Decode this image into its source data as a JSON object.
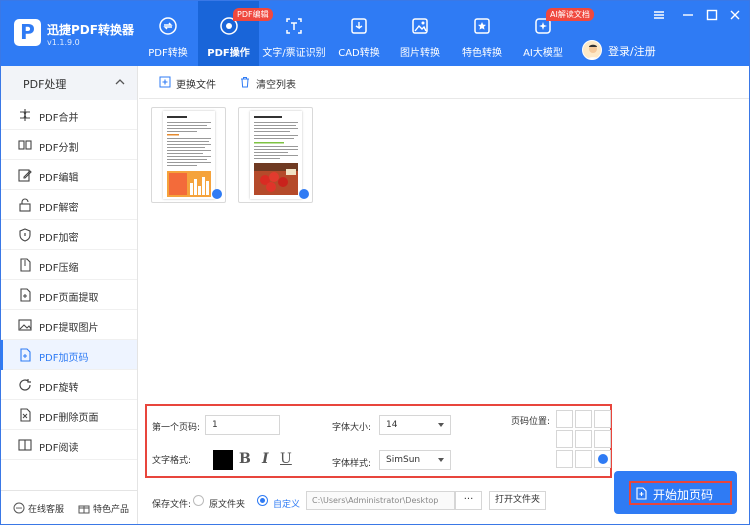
{
  "app": {
    "name": "迅捷PDF转换器",
    "version": "v1.1.9.0",
    "logo_letter": "P"
  },
  "nav": [
    {
      "label": "PDF转换",
      "icon": "pdf-convert-icon"
    },
    {
      "label": "PDF操作",
      "icon": "pdf-operate-icon",
      "badge": "PDF编辑",
      "active": true
    },
    {
      "label": "文字/票证识别",
      "icon": "ocr-icon"
    },
    {
      "label": "CAD转换",
      "icon": "cad-icon"
    },
    {
      "label": "图片转换",
      "icon": "image-icon"
    },
    {
      "label": "特色转换",
      "icon": "special-icon"
    },
    {
      "label": "AI大模型",
      "icon": "ai-icon",
      "badge": "AI解读文档"
    }
  ],
  "user": {
    "login_label": "登录/注册"
  },
  "sidebar": {
    "title": "PDF处理",
    "items": [
      {
        "label": "PDF合并",
        "icon": "merge-icon"
      },
      {
        "label": "PDF分割",
        "icon": "split-icon"
      },
      {
        "label": "PDF编辑",
        "icon": "edit-icon"
      },
      {
        "label": "PDF解密",
        "icon": "unlock-icon"
      },
      {
        "label": "PDF加密",
        "icon": "shield-icon"
      },
      {
        "label": "PDF压缩",
        "icon": "compress-icon"
      },
      {
        "label": "PDF页面提取",
        "icon": "page-extract-icon"
      },
      {
        "label": "PDF提取图片",
        "icon": "image-extract-icon"
      },
      {
        "label": "PDF加页码",
        "icon": "page-number-icon",
        "active": true
      },
      {
        "label": "PDF旋转",
        "icon": "rotate-icon"
      },
      {
        "label": "PDF删除页面",
        "icon": "delete-page-icon"
      },
      {
        "label": "PDF阅读",
        "icon": "book-icon"
      }
    ],
    "footer": {
      "service": "在线客服",
      "featured": "特色产品"
    }
  },
  "toolbar": {
    "replace_file": "更换文件",
    "clear_list": "清空列表"
  },
  "settings": {
    "first_page_label": "第一个页码:",
    "first_page_value": "1",
    "font_size_label": "字体大小:",
    "font_size_value": "14",
    "text_format_label": "文字格式:",
    "text_color": "#000000",
    "bold": "B",
    "italic": "I",
    "underline": "U",
    "font_style_label": "字体样式:",
    "font_style_value": "SimSun",
    "position_label": "页码位置:",
    "position_selected": "bottom-right"
  },
  "save": {
    "label": "保存文件:",
    "option_source": "原文件夹",
    "option_custom": "自定义",
    "selected": "自定义",
    "path": "C:\\Users\\Administrator\\Desktop",
    "browse": "···",
    "open_folder": "打开文件夹"
  },
  "start_button": "开始加页码",
  "colors": {
    "primary": "#2f7bf4",
    "highlight": "#e8453c",
    "badge": "#f0483e"
  }
}
